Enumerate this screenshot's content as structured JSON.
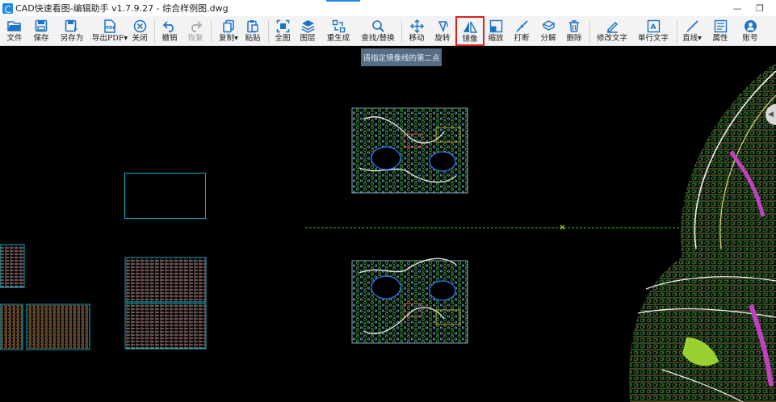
{
  "window": {
    "title": "CAD快速看图-编辑助手 v1.7.9.27 - 综合样例图.dwg",
    "minimize_glyph": "—",
    "restore_glyph": "❐"
  },
  "toolbar": {
    "file": "文件",
    "save": "保存",
    "save_as": "另存为",
    "export_pdf": "导出PDF",
    "close": "关闭",
    "undo": "撤销",
    "redo": "恢复",
    "copy": "复制",
    "paste": "粘贴",
    "full_view": "全图",
    "layers": "图层",
    "regen": "重生成",
    "find_replace": "查找/替换",
    "move": "移动",
    "rotate": "旋转",
    "mirror": "镜像",
    "scale": "缩放",
    "break": "打断",
    "explode": "分解",
    "delete": "删除",
    "edit_text": "修改文字",
    "single_line_text": "单行文字",
    "line": "直线",
    "properties": "属性",
    "account": "账号"
  },
  "tooltip": {
    "text": "请指定镜像线的第二点"
  },
  "colors": {
    "toolbar_icon": "#1e73c8",
    "active_outline": "#e02020",
    "canvas_bg": "#000000",
    "mirror_line": "#22cc22",
    "frame_cyan": "#00b0c8",
    "tooltip_bg": "#556d85"
  }
}
